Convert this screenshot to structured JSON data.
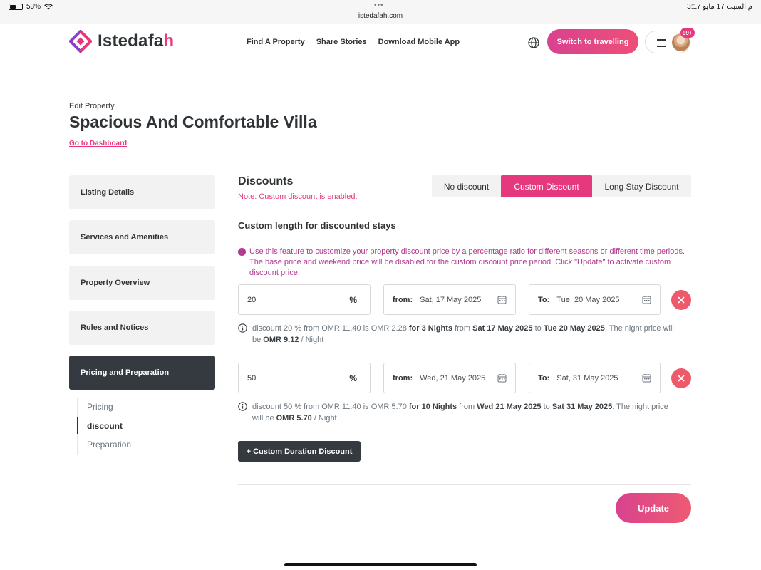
{
  "status_bar": {
    "battery": "53%",
    "battery_level": 0.53,
    "dots": "•••",
    "url": "istedafah.com",
    "time_date": "3:17 م  السبت 17 مايو"
  },
  "header": {
    "logo_text_main": "Istedafa",
    "logo_text_accent": "h",
    "nav": [
      "Find A Property",
      "Share Stories",
      "Download Mobile App"
    ],
    "switch_label": "Switch to travelling",
    "notification_badge": "99+",
    "icons": {
      "globe": "globe-icon",
      "menu": "hamburger-icon"
    },
    "colors": {
      "brand_pink": "#e6397d",
      "brand_purple": "#8a3fc8",
      "dark": "#2f3336"
    }
  },
  "page": {
    "edit_label": "Edit Property",
    "title": "Spacious And Comfortable Villa",
    "dashboard_link": "Go to Dashboard"
  },
  "sidebar": {
    "items": [
      {
        "label": "Listing Details",
        "active": false
      },
      {
        "label": "Services and Amenities",
        "active": false
      },
      {
        "label": "Property Overview",
        "active": false
      },
      {
        "label": "Rules and Notices",
        "active": false
      },
      {
        "label": "Pricing and Preparation",
        "active": true
      }
    ],
    "sub_items": [
      {
        "label": "Pricing",
        "current": false
      },
      {
        "label": "discount",
        "current": true
      },
      {
        "label": "Preparation",
        "current": false
      }
    ]
  },
  "discounts": {
    "title": "Discounts",
    "note": "Note: Custom discount is enabled.",
    "tabs": [
      "No discount",
      "Custom Discount",
      "Long Stay Discount"
    ],
    "selected_tab": "Custom Discount",
    "custom_title": "Custom length for discounted stays",
    "info": "Use this feature to customize your property discount price by a percentage ratio for different seasons or different time periods. The base price and weekend price will be disabled for the custom discount price period. Click \"Update\" to activate custom discount price.",
    "percent_symbol": "%",
    "from_label": "from:",
    "to_label": "To:",
    "rows": [
      {
        "percent": "20",
        "from": "Sat, 17 May 2025",
        "to": "Tue, 20 May 2025",
        "summary": {
          "p1": "discount 20 % from OMR 11.40 is OMR 2.28 ",
          "b1": "for 3 Nights",
          "p2": " from ",
          "b2": "Sat 17 May 2025",
          "p3": " to ",
          "b3": "Tue 20 May 2025",
          "p4": ". The night price will be ",
          "b4": "OMR 9.12",
          "p5": " / Night"
        }
      },
      {
        "percent": "50",
        "from": "Wed, 21 May 2025",
        "to": "Sat, 31 May 2025",
        "summary": {
          "p1": "discount 50 % from OMR 11.40 is OMR 5.70 ",
          "b1": "for 10 Nights",
          "p2": " from ",
          "b2": "Wed 21 May 2025",
          "p3": " to ",
          "b3": "Sat 31 May 2025",
          "p4": ". The night price will be ",
          "b4": "OMR 5.70",
          "p5": " / Night"
        }
      }
    ],
    "add_button": "+ Custom Duration Discount",
    "update_button": "Update"
  }
}
